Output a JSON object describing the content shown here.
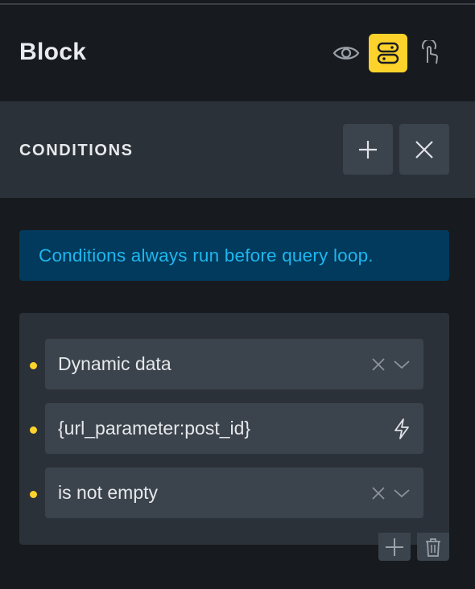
{
  "header": {
    "title": "Block"
  },
  "conditions": {
    "title": "CONDITIONS"
  },
  "info": {
    "message": "Conditions always run before query loop."
  },
  "condition_group": {
    "fields": [
      {
        "value": "Dynamic data",
        "type": "select"
      },
      {
        "value": "{url_parameter:post_id}",
        "type": "text"
      },
      {
        "value": "is not empty",
        "type": "select"
      }
    ]
  },
  "icons": [
    "eye-icon",
    "conditions-icon",
    "touch-icon",
    "plus-icon",
    "close-icon",
    "chevron-down-icon",
    "bolt-icon",
    "trash-icon"
  ],
  "colors": {
    "accent": "#fdd32b",
    "info_bg": "#013a5c",
    "info_text": "#1fb6ef"
  }
}
